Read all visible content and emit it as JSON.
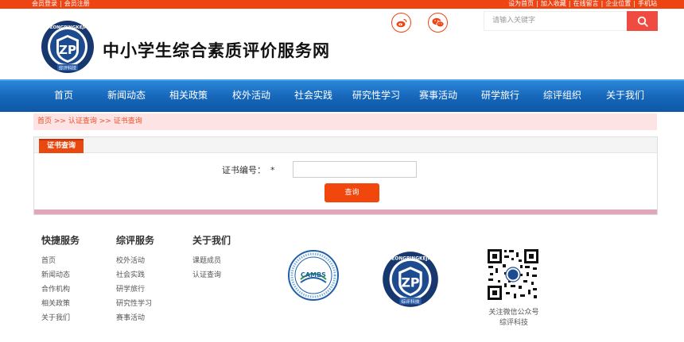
{
  "topbar": {
    "left_links": [
      "会员登录",
      "会员注册"
    ],
    "right_links": [
      "设为首页",
      "加入收藏",
      "在线留言",
      "企业位置",
      "手机站"
    ]
  },
  "header": {
    "logo_letters": "ZP",
    "logo_ring_text": "ZONGPINGKEJI",
    "logo_bottom_text": "综评科技",
    "site_title": "中小学生综合素质评价服务网",
    "search": {
      "placeholder": "请输入关键字"
    }
  },
  "nav": {
    "items": [
      "首页",
      "新闻动态",
      "相关政策",
      "校外活动",
      "社会实践",
      "研究性学习",
      "赛事活动",
      "研学旅行",
      "综评组织",
      "关于我们"
    ]
  },
  "breadcrumb": {
    "items": [
      "首页",
      "认证查询",
      "证书查询"
    ],
    "separator": ">>"
  },
  "panel": {
    "tab_label": "证书查询",
    "field_label": "证书编号：",
    "required_mark": "*",
    "input_value": "",
    "button_label": "查询"
  },
  "footer": {
    "columns": [
      {
        "title": "快捷服务",
        "links": [
          "首页",
          "新闻动态",
          "合作机构",
          "相关政策",
          "关于我们"
        ]
      },
      {
        "title": "综评服务",
        "links": [
          "校外活动",
          "社会实践",
          "研学旅行",
          "研究性学习",
          "赛事活动"
        ]
      },
      {
        "title": "关于我们",
        "links": [
          "课题成员",
          "认证查询"
        ]
      }
    ],
    "cambs_seal_text": "CAMBS",
    "qr_caption_line1": "关注微信公众号",
    "qr_caption_line2": "综评科技"
  },
  "colors": {
    "accent": "#ee4312",
    "nav_blue": "#1565b8",
    "breadcrumb_bg": "#fde3e3"
  },
  "icons": [
    "weibo-icon",
    "wechat-icon",
    "search-icon",
    "qr-code-icon"
  ]
}
